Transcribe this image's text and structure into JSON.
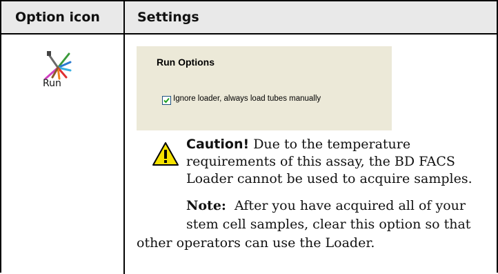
{
  "header": {
    "col1": "Option icon",
    "col2": "Settings"
  },
  "option": {
    "icon": "run-icon",
    "label": "Run"
  },
  "dialog": {
    "title": "Run Options",
    "checkbox_checked": true,
    "checkbox_label": "Ignore loader, always load tubes manually"
  },
  "caution": {
    "icon": "warning-triangle-icon",
    "label": "Caution!",
    "text": "Due to the temperature requirements of this assay, the BD FACS Loader cannot be used to acquire samples."
  },
  "note": {
    "label": "Note:",
    "line1": "After you have acquired all of your",
    "line2": "stem cell samples, clear this option so that",
    "line3": "other operators can use the Loader."
  },
  "colors": {
    "header_bg": "#e9e9e9",
    "dialog_bg": "#ece9d8",
    "warning_yellow": "#f5e200"
  }
}
